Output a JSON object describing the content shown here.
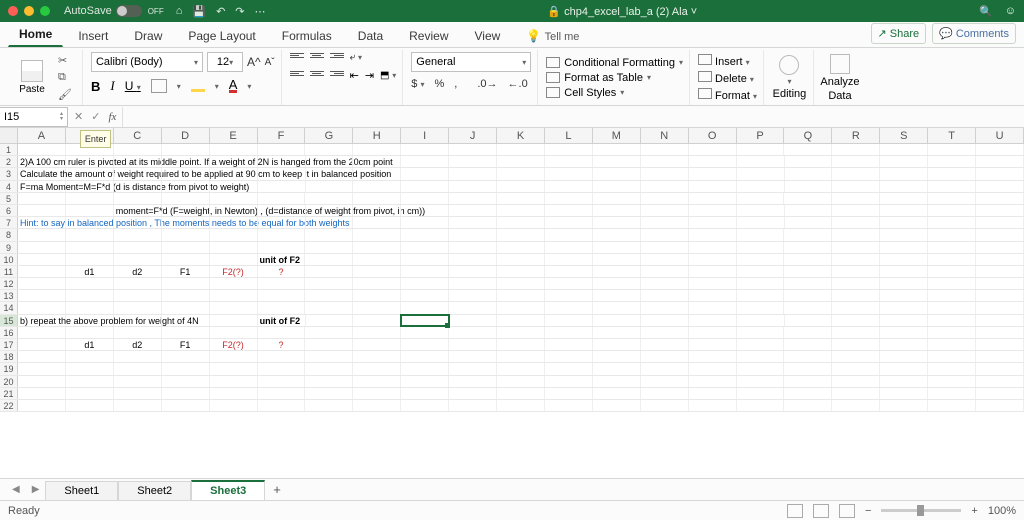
{
  "title_bar": {
    "autosave_label": "AutoSave",
    "autosave_state": "OFF",
    "doc_title": "chp4_excel_lab_a (2) Ala"
  },
  "tabs": {
    "items": [
      "Home",
      "Insert",
      "Draw",
      "Page Layout",
      "Formulas",
      "Data",
      "Review",
      "View"
    ],
    "tell_me": "Tell me",
    "share": "Share",
    "comments": "Comments"
  },
  "ribbon": {
    "paste": "Paste",
    "font_name": "Calibri (Body)",
    "font_size": "12",
    "number_format": "General",
    "cond_fmt": "Conditional Formatting",
    "fmt_table": "Format as Table",
    "cell_styles": "Cell Styles",
    "insert": "Insert",
    "delete": "Delete",
    "format": "Format",
    "editing": "Editing",
    "analyze": "Analyze",
    "analyze2": "Data"
  },
  "namebox": {
    "ref": "I15",
    "tooltip": "Enter"
  },
  "cells": {
    "r2": "2)A 100 cm ruler is pivoted at its middle point. If a weight of 2N is hanged from the 20cm point",
    "r3": "Calculate the amount of weight required to be applied at 90 cm to keep it in balanced position",
    "r4": "F=ma  Moment=M=F*d   (d is distance from pivot to weight)",
    "r6": "moment=F*d   (F=weight, in Newton) , (d=distance of weight from pivot, in cm))",
    "r7": "Hint: to say in balanced position , The moments needs to be equal for both weights",
    "r10f": "unit of F2",
    "r11": {
      "b": "d1",
      "c": "d2",
      "d": "F1",
      "e": "F2(?)",
      "f": "?"
    },
    "r15a": "b) repeat the above problem for weight of 4N",
    "r15f": "unit of F2",
    "r17": {
      "b": "d1",
      "c": "d2",
      "d": "F1",
      "e": "F2(?)",
      "f": "?"
    }
  },
  "sheets": {
    "items": [
      "Sheet1",
      "Sheet2",
      "Sheet3"
    ],
    "active": 2,
    "add": "+"
  },
  "status": {
    "ready": "Ready",
    "zoom": "100%"
  },
  "columns": [
    "A",
    "B",
    "C",
    "D",
    "E",
    "F",
    "G",
    "H",
    "I",
    "J",
    "K",
    "L",
    "M",
    "N",
    "O",
    "P",
    "Q",
    "R",
    "S",
    "T",
    "U"
  ]
}
